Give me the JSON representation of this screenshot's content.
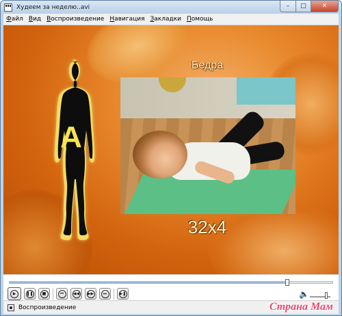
{
  "window": {
    "title": "Худеем за неделю..avi",
    "min_glyph": "–",
    "max_glyph": "□",
    "close_glyph": "✕"
  },
  "menu": {
    "items": [
      {
        "u": "Ф",
        "rest": "айл"
      },
      {
        "u": "В",
        "rest": "ид"
      },
      {
        "u": "В",
        "rest": "оспроизведение"
      },
      {
        "u": "Н",
        "rest": "авигация"
      },
      {
        "u": "З",
        "rest": "акладки"
      },
      {
        "u": "П",
        "rest": "омощь"
      }
    ]
  },
  "video": {
    "section_title": "Бедра",
    "figure_letter": "A",
    "reps": "32x4",
    "accent": "#e98a2e",
    "text_color": "#fbf4c8"
  },
  "playback": {
    "position_fraction": 0.86,
    "volume_fraction": 0.8,
    "buttons": [
      {
        "name": "play-button",
        "glyph": "▶"
      },
      {
        "name": "pause-button",
        "glyph": "❚❚"
      },
      {
        "name": "stop-button",
        "glyph": "■"
      },
      {
        "name": "previous-button",
        "glyph": "⏮"
      },
      {
        "name": "rewind-button",
        "glyph": "◀◀"
      },
      {
        "name": "fast-forward-button",
        "glyph": "▶▶"
      },
      {
        "name": "next-button",
        "glyph": "⏭"
      },
      {
        "name": "frame-step-button",
        "glyph": "▶❚"
      }
    ]
  },
  "status": {
    "text": "Воспроизведение",
    "watermark": "Страна Мам"
  },
  "icons": {
    "volume": "speaker-icon",
    "app": "film-icon"
  }
}
